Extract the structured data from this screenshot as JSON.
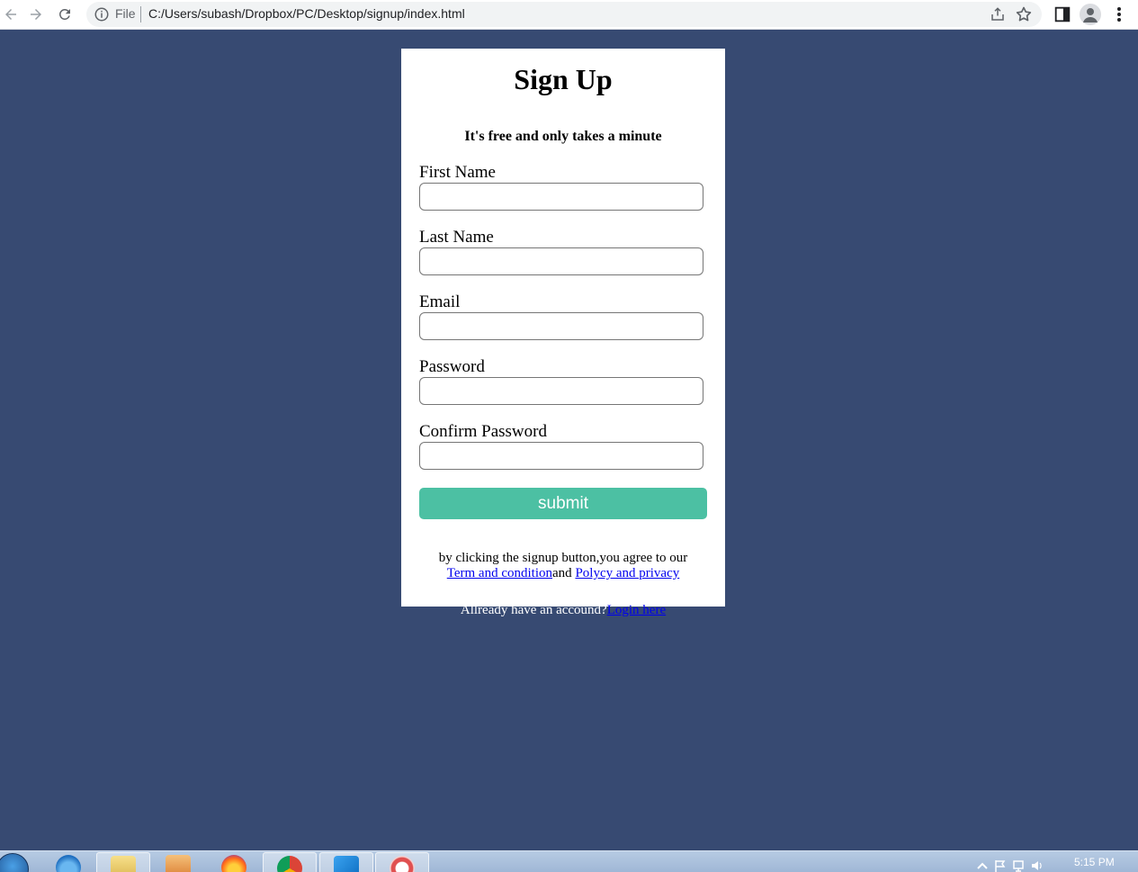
{
  "browser": {
    "scheme_label": "File",
    "url": "C:/Users/subash/Dropbox/PC/Desktop/signup/index.html"
  },
  "form": {
    "title": "Sign Up",
    "subtitle": "It's free and only takes a minute",
    "fields": [
      {
        "label": "First Name",
        "value": ""
      },
      {
        "label": "Last Name",
        "value": ""
      },
      {
        "label": "Email",
        "value": ""
      },
      {
        "label": "Password",
        "value": ""
      },
      {
        "label": "Confirm Password",
        "value": ""
      }
    ],
    "submit_label": "submit",
    "terms_text": "by clicking the signup button,you agree to our",
    "terms_link": "Term and condition",
    "terms_and": "and",
    "privacy_link": "Polycy and privacy",
    "login_prompt": "Allready have an accound?",
    "login_link": "Login here"
  },
  "taskbar": {
    "clock": "5:15 PM",
    "apps": [
      "internet-explorer",
      "file-explorer",
      "media-player",
      "firefox",
      "chrome",
      "vscode",
      "snipping-tool"
    ]
  },
  "colors": {
    "page_background": "#374a72",
    "card_background": "#ffffff",
    "submit_button": "#4cc0a3",
    "link": "#0000ee"
  }
}
